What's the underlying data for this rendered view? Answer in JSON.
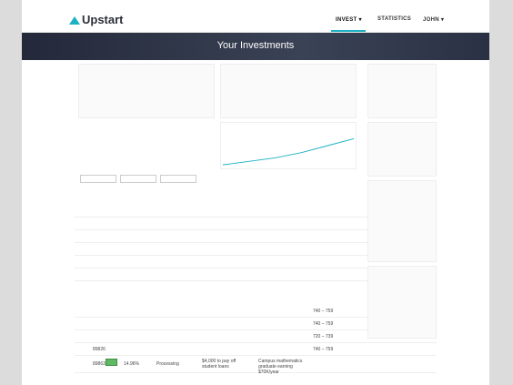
{
  "header": {
    "brand": "Upstart",
    "nav": [
      {
        "label": "INVEST",
        "active": true
      },
      {
        "label": "STATISTICS",
        "active": false
      },
      {
        "label": "JOHN",
        "active": false
      }
    ]
  },
  "hero": {
    "title": "Your Investments"
  },
  "rows": [
    {
      "id": "89826",
      "rate": "",
      "status": "",
      "purpose": "",
      "score": "740 – 759"
    },
    {
      "id": "89863",
      "rate": "14.96%",
      "status": "Processing",
      "purpose": "$4,000 to pay off student loans",
      "desc": "Campus mathematics graduate earning $70K/year",
      "score": "740 – 759"
    }
  ],
  "table_scores": [
    "740 – 759",
    "740 – 759",
    "720 – 739",
    "740 – 759"
  ],
  "colors": {
    "accent": "#1bb1c2",
    "hero_bg": "#2a3144",
    "grade_green": "#4caf50"
  }
}
